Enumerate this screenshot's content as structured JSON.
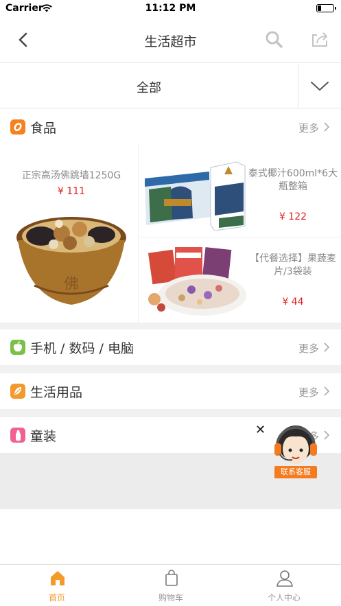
{
  "status_bar": {
    "carrier": "Carrier",
    "time": "11:12 PM"
  },
  "nav": {
    "title": "生活超市"
  },
  "filter": {
    "label": "全部"
  },
  "categories": [
    {
      "title": "食品",
      "more": "更多",
      "color": "#f5821f"
    },
    {
      "title": "手机 / 数码 / 电脑",
      "more": "更多",
      "color": "#7cc04b"
    },
    {
      "title": "生活用品",
      "more": "更多",
      "color": "#f39a2e"
    },
    {
      "title": "童装",
      "more": "更多",
      "color": "#f06292"
    }
  ],
  "products": [
    {
      "name": "正宗高汤佛跳墙1250G",
      "price": "¥ 111"
    },
    {
      "name": "泰式椰汁600ml*6大瓶整箱",
      "price": "¥ 122"
    },
    {
      "name": "【代餐选择】果蔬麦片/3袋装",
      "price": "¥ 44"
    }
  ],
  "customer_service": {
    "label": "联系客服"
  },
  "tabbar": [
    {
      "label": "首页",
      "active": true
    },
    {
      "label": "购物车",
      "active": false
    },
    {
      "label": "个人中心",
      "active": false
    }
  ],
  "colors": {
    "accent": "#f49a2a",
    "price": "#e02020",
    "separator": "#f1f1f1"
  }
}
